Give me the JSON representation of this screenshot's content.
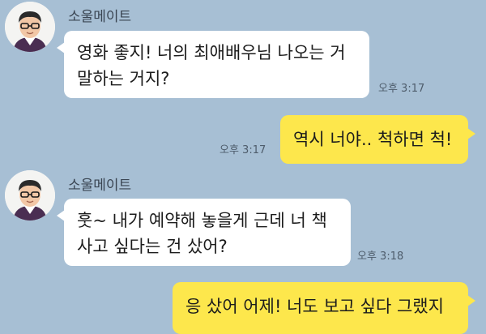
{
  "messages": [
    {
      "direction": "incoming",
      "sender": "소울메이트",
      "lines": [
        "영화 좋지! 너의 최애배우님 나오는 거",
        "말하는 거지?"
      ],
      "time": "오후 3:17"
    },
    {
      "direction": "outgoing",
      "lines": [
        "역시 너야.. 척하면 척!"
      ],
      "time": "오후 3:17"
    },
    {
      "direction": "incoming",
      "sender": "소울메이트",
      "lines": [
        "훗~ 내가 예약해 놓을게 근데 너 책",
        "사고 싶다는 건 샀어?"
      ],
      "time": "오후 3:18"
    },
    {
      "direction": "outgoing",
      "lines": [
        "응 샀어 어제! 너도 보고 싶다 그랬지"
      ],
      "time": ""
    }
  ],
  "colors": {
    "chat_background": "#a7bfd4",
    "incoming_bubble": "#ffffff",
    "outgoing_bubble": "#fde74c"
  },
  "avatar_icon": "child-with-glasses-avatar-icon"
}
